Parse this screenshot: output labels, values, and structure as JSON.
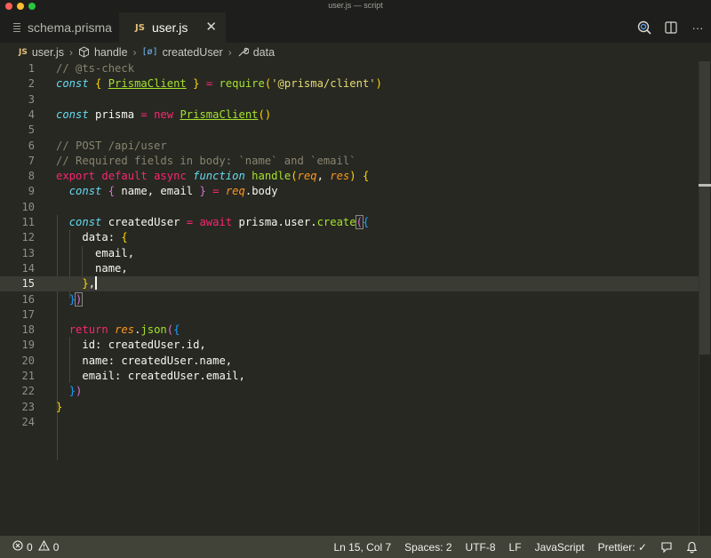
{
  "window": {
    "title": "user.js — script"
  },
  "tabs": [
    {
      "label": "schema.prisma",
      "icon": "lines-icon",
      "active": false
    },
    {
      "label": "user.js",
      "icon": "js-icon",
      "active": true,
      "close": "✕"
    }
  ],
  "toolbar": {
    "icons": [
      "search-icon",
      "split-editor-icon",
      "more-icon"
    ],
    "more_label": "···"
  },
  "breadcrumb": {
    "items": [
      "user.js",
      "handle",
      "createdUser",
      "data"
    ]
  },
  "editor": {
    "line_numbers": [
      "1",
      "2",
      "3",
      "4",
      "5",
      "6",
      "7",
      "8",
      "9",
      "10",
      "11",
      "12",
      "13",
      "14",
      "15",
      "16",
      "17",
      "18",
      "19",
      "20",
      "21",
      "22",
      "23",
      "24"
    ],
    "current_line": 15,
    "code": {
      "l1": "// @ts-check",
      "l2_const": "const",
      "l2_open": "{",
      "l2_cls": "PrismaClient",
      "l2_close": "}",
      "l2_eq": "=",
      "l2_fn": "require",
      "l2_str": "'@prisma/client'",
      "l4_const": "const",
      "l4_var": "prisma",
      "l4_eq": "=",
      "l4_new": "new",
      "l4_cls": "PrismaClient",
      "l4_paren": "()",
      "l6": "// POST /api/user",
      "l7": "// Required fields in body: `name` and `email`",
      "l8_export": "export",
      "l8_default": "default",
      "l8_async": "async",
      "l8_function": "function",
      "l8_name": "handle",
      "l8_req": "req",
      "l8_res": "res",
      "l8_brace": "{",
      "l9_const": "const",
      "l9_open": "{",
      "l9_vars": "name, email",
      "l9_close": "}",
      "l9_eq": "=",
      "l9_req": "req",
      "l9_prop": ".body",
      "l11_const": "const",
      "l11_var": "createdUser",
      "l11_eq": "=",
      "l11_await": "await",
      "l11_chain": "prisma.user.",
      "l11_fn": "create",
      "l12_key": "data:",
      "l12_brace": "{",
      "l13": "email,",
      "l14": "name,",
      "l15_brace": "}",
      "l15_comma": ",",
      "l16_brace": "}",
      "l16_paren": ")",
      "l18_return": "return",
      "l18_res": "res",
      "l18_fn": "json",
      "l19": "id: createdUser.id,",
      "l20": "name: createdUser.name,",
      "l21": "email: createdUser.email,",
      "l22_brace": "}",
      "l22_paren": ")",
      "l23": "}"
    }
  },
  "statusbar": {
    "errors": "0",
    "warnings": "0",
    "position": "Ln 15, Col 7",
    "spaces": "Spaces: 2",
    "encoding": "UTF-8",
    "eol": "LF",
    "language": "JavaScript",
    "formatter": "Prettier: ✓"
  },
  "colors": {
    "editor_bg": "#272822",
    "keyword": "#66d9ef",
    "operator": "#f92672",
    "function": "#a6e22e",
    "string": "#e6db74",
    "comment": "#88846f",
    "param": "#fd971f",
    "statusbar_bg": "#414339"
  }
}
